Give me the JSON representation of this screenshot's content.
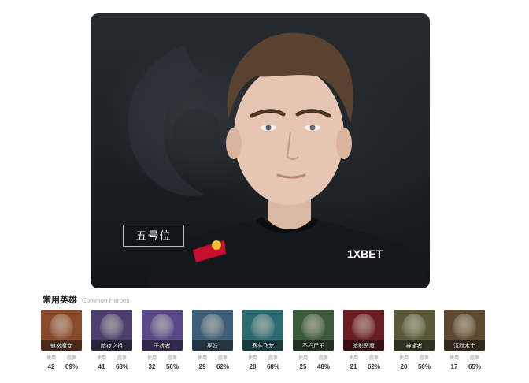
{
  "player": {
    "position_label": "五号位",
    "jersey_sponsor": "1XBET"
  },
  "common_heroes": {
    "title": "常用英雄",
    "subtitle": "Common Heroes",
    "usage_label": "使用",
    "winrate_label": "胜率",
    "items": [
      {
        "name": "魅惑魔女",
        "uses": "42",
        "winrate": "69%",
        "icon": "enchantress-portrait",
        "color": "#8a4a2c"
      },
      {
        "name": "暗夜之祖",
        "uses": "41",
        "winrate": "68%",
        "icon": "night-stalker-portrait",
        "color": "#4c3f6e"
      },
      {
        "name": "干扰者",
        "uses": "32",
        "winrate": "56%",
        "icon": "disruptor-portrait",
        "color": "#5b4a8a"
      },
      {
        "name": "巫妖",
        "uses": "29",
        "winrate": "62%",
        "icon": "lich-portrait",
        "color": "#3e5f78"
      },
      {
        "name": "寒冬飞龙",
        "uses": "28",
        "winrate": "68%",
        "icon": "winter-wyvern-portrait",
        "color": "#2d6b72"
      },
      {
        "name": "不朽尸王",
        "uses": "25",
        "winrate": "48%",
        "icon": "undying-portrait",
        "color": "#3d5a3c"
      },
      {
        "name": "暗影恶魔",
        "uses": "21",
        "winrate": "62%",
        "icon": "shadow-demon-portrait",
        "color": "#6a1e24"
      },
      {
        "name": "神谕者",
        "uses": "20",
        "winrate": "50%",
        "icon": "oracle-portrait",
        "color": "#5a5a3a"
      },
      {
        "name": "沉默术士",
        "uses": "17",
        "winrate": "65%",
        "icon": "silencer-portrait",
        "color": "#5e4a30"
      }
    ]
  }
}
